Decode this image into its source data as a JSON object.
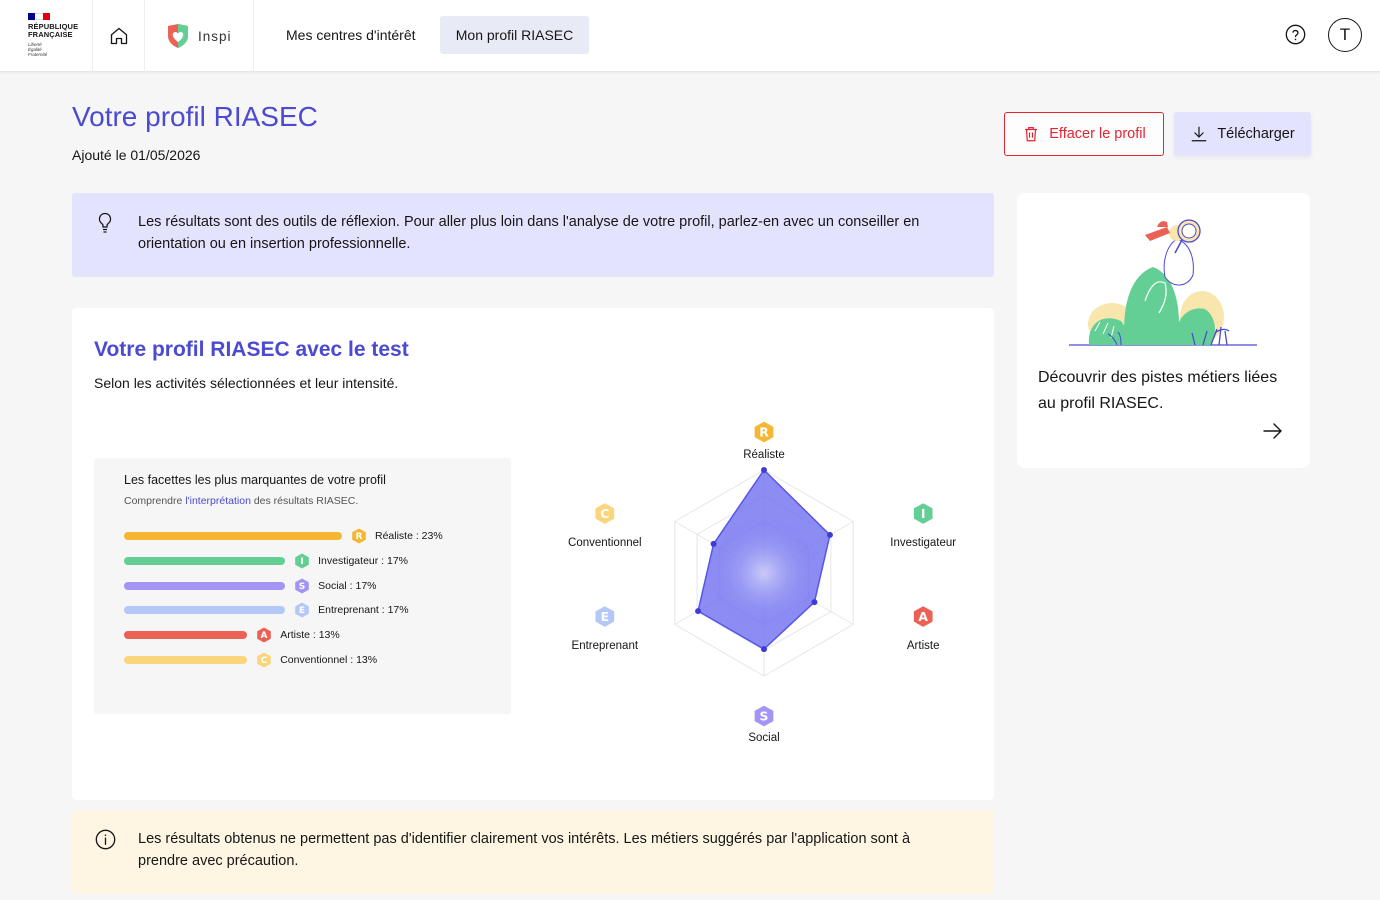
{
  "header": {
    "rf_name_line1": "RÉPUBLIQUE",
    "rf_name_line2": "FRANÇAISE",
    "rf_motto": [
      "Liberté",
      "Égalité",
      "Fraternité"
    ],
    "app_name": "Inspi",
    "nav_interets": "Mes centres d'intérêt",
    "nav_profil": "Mon profil RIASEC",
    "avatar_initial": "T"
  },
  "page": {
    "title": "Votre profil RIASEC",
    "added": "Ajouté le 01/05/2026",
    "clear_button": "Effacer le profil",
    "download_button": "Télécharger"
  },
  "info_callout": "Les résultats sont des outils de réflexion. Pour aller plus loin dans l'analyse de votre profil, parlez-en avec un conseiller en orientation ou en insertion professionnelle.",
  "profile_card": {
    "title": "Votre profil RIASEC avec le test",
    "subtitle": "Selon les activités sélectionnées et leur intensité.",
    "facets_title": "Les facettes les plus marquantes de votre profil",
    "facets_sub_before": "Comprendre ",
    "facets_sub_link": "l'interprétation",
    "facets_sub_after": " des résultats RIASEC.",
    "facets": [
      {
        "letter": "R",
        "label": "Réaliste : 23%",
        "percent": 23,
        "color": "#f5b731"
      },
      {
        "letter": "I",
        "label": "Investigateur : 17%",
        "percent": 17,
        "color": "#63cf95"
      },
      {
        "letter": "S",
        "label": "Social : 17%",
        "percent": 17,
        "color": "#a394f5"
      },
      {
        "letter": "E",
        "label": "Entreprenant : 17%",
        "percent": 17,
        "color": "#b4c8f7"
      },
      {
        "letter": "A",
        "label": "Artiste : 13%",
        "percent": 13,
        "color": "#ec6156"
      },
      {
        "letter": "C",
        "label": "Conventionnel : 13%",
        "percent": 13,
        "color": "#fad57c"
      }
    ]
  },
  "chart_data": {
    "type": "radar",
    "axes": [
      "Réaliste",
      "Investigateur",
      "Artiste",
      "Social",
      "Entreprenant",
      "Conventionnel"
    ],
    "letters": [
      "R",
      "I",
      "A",
      "S",
      "E",
      "C"
    ],
    "axis_colors": [
      "#f5b731",
      "#63cf95",
      "#ec6156",
      "#a394f5",
      "#b4c8f7",
      "#fad57c"
    ],
    "values": [
      23,
      17,
      13,
      17,
      17,
      13
    ],
    "max": 23,
    "fill_color": "#6b6bf0"
  },
  "side_card": {
    "text": "Découvrir des pistes métiers liées au profil RIASEC."
  },
  "warning_callout": "Les résultats obtenus ne permettent pas d'identifier clairement vos intérêts. Les métiers suggérés par l'application sont à prendre avec précaution."
}
